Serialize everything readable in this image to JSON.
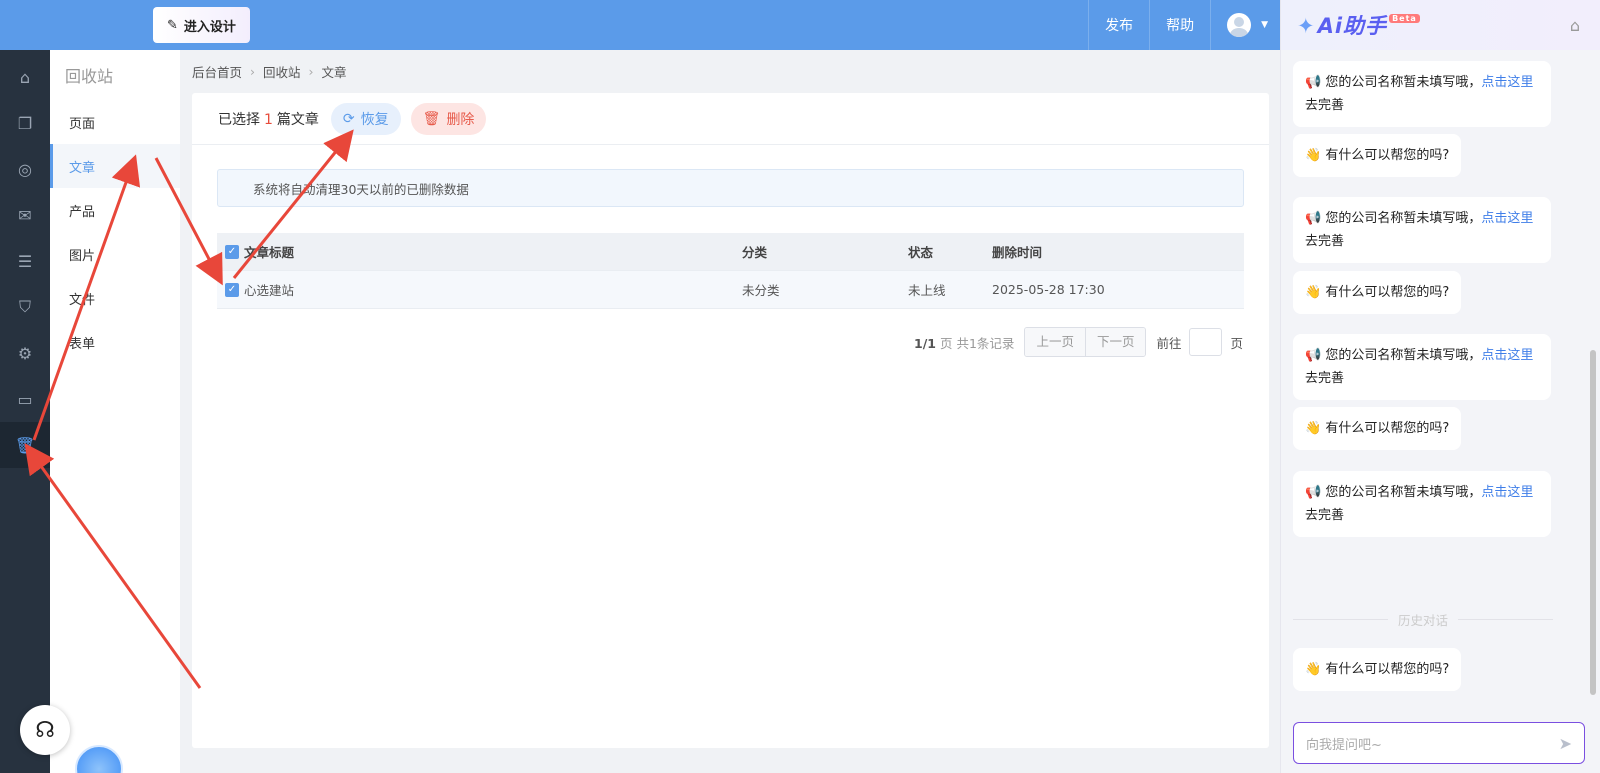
{
  "topbar": {
    "design_button": "进入设计",
    "links": [
      "发布",
      "帮助"
    ]
  },
  "rail": {
    "icons": [
      "home-icon",
      "pages-icon",
      "planet-icon",
      "wechat-icon",
      "list-icon",
      "shop-bag-icon",
      "settings-icon",
      "terminal-icon",
      "trash-icon"
    ],
    "active_index": 8
  },
  "subnav": {
    "title": "回收站",
    "items": [
      "页面",
      "文章",
      "产品",
      "图片",
      "文件",
      "表单"
    ],
    "active_index": 1
  },
  "breadcrumb": [
    "后台首页",
    "回收站",
    "文章"
  ],
  "toolbar": {
    "selected_prefix": "已选择",
    "selected_count": "1",
    "selected_suffix": "篇文章",
    "restore_label": "恢复",
    "delete_label": "删除"
  },
  "notice": "系统将自动清理30天以前的已删除数据",
  "table": {
    "headers": [
      "文章标题",
      "分类",
      "状态",
      "删除时间"
    ],
    "rows": [
      {
        "title": "心选建站",
        "category": "未分类",
        "status": "未上线",
        "deleted_at": "2025-05-28 17:30"
      }
    ]
  },
  "pager": {
    "page_info": "1/1",
    "page_unit": "页 共1条记录",
    "prev": "上一页",
    "next": "下一页",
    "goto_prefix": "前往",
    "goto_suffix": "页"
  },
  "ai": {
    "title": "Ai助手",
    "beta": "Beta",
    "messages": [
      {
        "type": "notice",
        "text": "您的公司名称暂未填写哦，",
        "link": "点击这里",
        "after": "去完善"
      },
      {
        "type": "greet",
        "text": "有什么可以帮您的吗?"
      },
      {
        "type": "notice",
        "text": "您的公司名称暂未填写哦，",
        "link": "点击这里",
        "after": "去完善"
      },
      {
        "type": "greet",
        "text": "有什么可以帮您的吗?"
      },
      {
        "type": "notice",
        "text": "您的公司名称暂未填写哦，",
        "link": "点击这里",
        "after": "去完善"
      },
      {
        "type": "greet",
        "text": "有什么可以帮您的吗?"
      },
      {
        "type": "notice",
        "text": "您的公司名称暂未填写哦，",
        "link": "点击这里",
        "after": "去完善"
      },
      {
        "type": "greet",
        "text": "有什么可以帮您的吗?"
      }
    ],
    "history_label": "历史对话",
    "input_placeholder": "向我提问吧~"
  },
  "colors": {
    "topbar": "#5b9be9",
    "rail": "#27323f",
    "accent": "#5b9be9",
    "danger": "#e75b4b",
    "annotation": "#e8473a"
  }
}
